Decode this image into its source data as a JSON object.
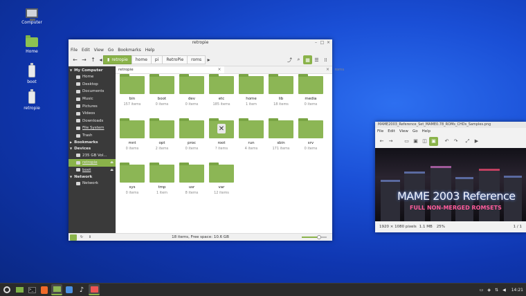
{
  "desktop": {
    "icons": [
      {
        "label": "Computer",
        "icon": "computer-icon"
      },
      {
        "label": "Home",
        "icon": "home-folder-icon"
      },
      {
        "label": "boot",
        "icon": "usb-drive-icon"
      },
      {
        "label": "retropie",
        "icon": "usb-drive-icon"
      }
    ]
  },
  "file_manager": {
    "title": "retropie",
    "menu": [
      "File",
      "Edit",
      "View",
      "Go",
      "Bookmarks",
      "Help"
    ],
    "breadcrumbs": [
      "retropie",
      "home",
      "pi",
      "RetroPie",
      "roms"
    ],
    "sidebar": {
      "my_computer": "My Computer",
      "places": [
        "Home",
        "Desktop",
        "Documents",
        "Music",
        "Pictures",
        "Videos",
        "Downloads",
        "File System",
        "Trash"
      ],
      "bookmarks": "Bookmarks",
      "devices": "Devices",
      "device_items": [
        "235 GB Vol...",
        "retropie",
        "boot"
      ],
      "network": "Network",
      "network_items": [
        "Network"
      ]
    },
    "tabs": [
      {
        "label": "retropie",
        "close": "×"
      },
      {
        "label": "roms",
        "close": "×"
      }
    ],
    "folders": [
      {
        "name": "bin",
        "count": "157 items"
      },
      {
        "name": "boot",
        "count": "0 items"
      },
      {
        "name": "dev",
        "count": "0 items"
      },
      {
        "name": "etc",
        "count": "185 items"
      },
      {
        "name": "home",
        "count": "1 item"
      },
      {
        "name": "lib",
        "count": "18 items"
      },
      {
        "name": "media",
        "count": "0 items"
      },
      {
        "name": "mnt",
        "count": "0 items"
      },
      {
        "name": "opt",
        "count": "2 items"
      },
      {
        "name": "proc",
        "count": "0 items"
      },
      {
        "name": "root",
        "count": "? items"
      },
      {
        "name": "run",
        "count": "4 items"
      },
      {
        "name": "sbin",
        "count": "171 items"
      },
      {
        "name": "srv",
        "count": "0 items"
      },
      {
        "name": "sys",
        "count": "0 items"
      },
      {
        "name": "tmp",
        "count": "1 item"
      },
      {
        "name": "usr",
        "count": "8 items"
      },
      {
        "name": "var",
        "count": "12 items"
      }
    ],
    "status": "18 items, Free space: 10.6 GB",
    "zoom_fraction": 0.7
  },
  "image_viewer": {
    "title": "MAME2003_Reference_Set_MAME0.78_ROMs_CHDs_Samples.png",
    "menu": [
      "File",
      "Edit",
      "View",
      "Go",
      "Help"
    ],
    "image_headline": "MAME 2003 Reference",
    "image_subline": "FULL NON-MERGED ROMSETS",
    "dimensions": "1920 × 1080 pixels",
    "size": "1.1 MB",
    "zoom": "25%",
    "page": "1 / 1"
  },
  "taskbar": {
    "clock": "14:21"
  },
  "colors": {
    "accent": "#8ab34a",
    "sidebar_bg": "#3a3a3a",
    "desktop_blue": "#1a4fd6"
  }
}
